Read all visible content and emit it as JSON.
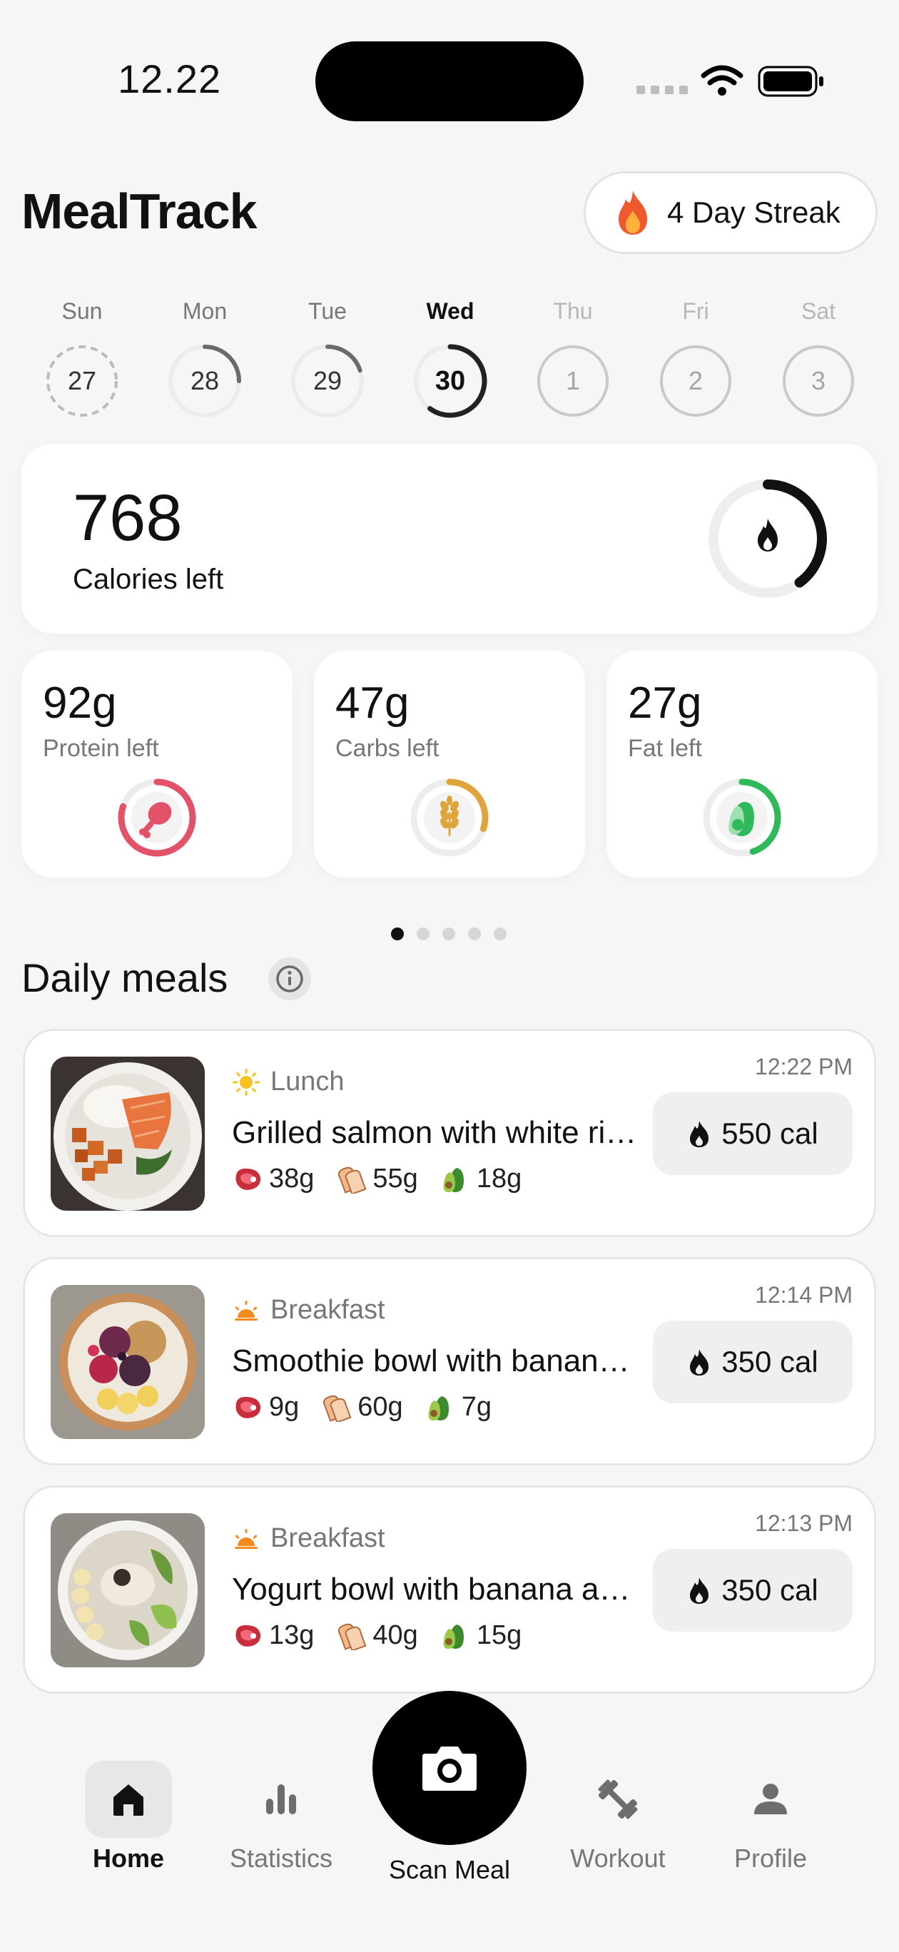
{
  "status_bar": {
    "time": "12.22"
  },
  "header": {
    "title": "MealTrack",
    "streak_label": "4 Day Streak"
  },
  "week": [
    {
      "day": "Sun",
      "date": "27",
      "state": "past",
      "progress": 0
    },
    {
      "day": "Mon",
      "date": "28",
      "state": "past",
      "progress": 0.25
    },
    {
      "day": "Tue",
      "date": "29",
      "state": "past",
      "progress": 0.2
    },
    {
      "day": "Wed",
      "date": "30",
      "state": "today",
      "progress": 0.6
    },
    {
      "day": "Thu",
      "date": "1",
      "state": "future",
      "progress": 0
    },
    {
      "day": "Fri",
      "date": "2",
      "state": "future",
      "progress": 0
    },
    {
      "day": "Sat",
      "date": "3",
      "state": "future",
      "progress": 0
    }
  ],
  "calories": {
    "value": "768",
    "label": "Calories left",
    "progress": 0.4
  },
  "macros": [
    {
      "value": "92g",
      "label": "Protein left",
      "icon": "drumstick-icon",
      "color": "#e2536a",
      "progress": 0.8
    },
    {
      "value": "47g",
      "label": "Carbs left",
      "icon": "wheat-icon",
      "color": "#e0a43d",
      "progress": 0.3
    },
    {
      "value": "27g",
      "label": "Fat left",
      "icon": "avocado-icon",
      "color": "#2fb95a",
      "progress": 0.45
    }
  ],
  "pager": {
    "count": 5,
    "active": 0
  },
  "meals_section": {
    "title": "Daily meals"
  },
  "meals": [
    {
      "type": "Lunch",
      "type_icon": "sun-icon",
      "name": "Grilled salmon with white rice and sweet potato",
      "protein": "38g",
      "carbs": "55g",
      "fat": "18g",
      "time": "12:22 PM",
      "calories": "550 cal"
    },
    {
      "type": "Breakfast",
      "type_icon": "sunrise-icon",
      "name": "Smoothie bowl with banana and berries",
      "protein": "9g",
      "carbs": "60g",
      "fat": "7g",
      "time": "12:14 PM",
      "calories": "350 cal"
    },
    {
      "type": "Breakfast",
      "type_icon": "sunrise-icon",
      "name": "Yogurt bowl with banana and avocado",
      "protein": "13g",
      "carbs": "40g",
      "fat": "15g",
      "time": "12:13 PM",
      "calories": "350 cal"
    }
  ],
  "nav": {
    "home": "Home",
    "statistics": "Statistics",
    "scan": "Scan Meal",
    "workout": "Workout",
    "profile": "Profile"
  },
  "colors": {
    "accent": "#111111",
    "protein": "#e2536a",
    "carbs": "#e0a43d",
    "fat": "#2fb95a",
    "flame": "#f0582f"
  }
}
